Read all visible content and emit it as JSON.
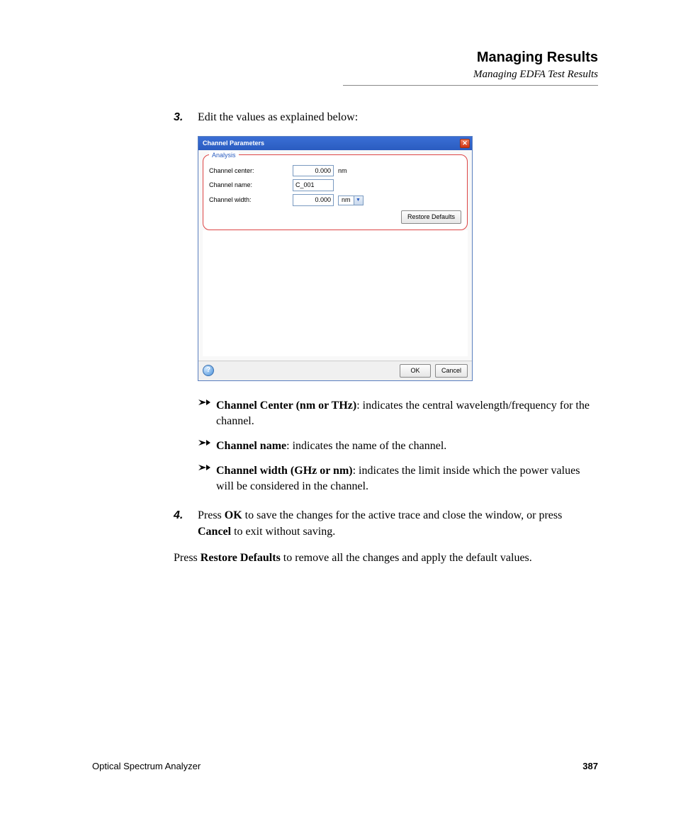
{
  "header": {
    "title": "Managing Results",
    "subtitle": "Managing EDFA Test Results"
  },
  "steps": {
    "s3": {
      "num": "3.",
      "text": "Edit the values as explained below:"
    },
    "s4": {
      "num": "4.",
      "pre": "Press ",
      "b1": "OK",
      "mid": " to save the changes for the active trace and close the window, or press ",
      "b2": "Cancel",
      "post": " to exit without saving."
    }
  },
  "dialog": {
    "title": "Channel Parameters",
    "group_legend": "Analysis",
    "rows": {
      "center": {
        "label": "Channel center:",
        "value": "0.000",
        "unit": "nm"
      },
      "name": {
        "label": "Channel name:",
        "value": "C_001"
      },
      "width": {
        "label": "Channel width:",
        "value": "0.000",
        "combo": "nm"
      }
    },
    "buttons": {
      "restore": "Restore Defaults",
      "ok": "OK",
      "cancel": "Cancel"
    },
    "help": "?"
  },
  "bullets": {
    "b1": {
      "bold": "Channel Center (nm or THz)",
      "rest": ": indicates the central wavelength/frequency for the channel."
    },
    "b2": {
      "bold": "Channel name",
      "rest": ": indicates the name of the channel."
    },
    "b3": {
      "bold": "Channel width (GHz or nm)",
      "rest": ": indicates the limit inside which the power values will be considered in the channel."
    }
  },
  "closing": {
    "pre": "Press ",
    "b": "Restore Defaults",
    "post": " to remove all the changes and apply the default values."
  },
  "footer": {
    "product": "Optical Spectrum Analyzer",
    "page": "387"
  }
}
